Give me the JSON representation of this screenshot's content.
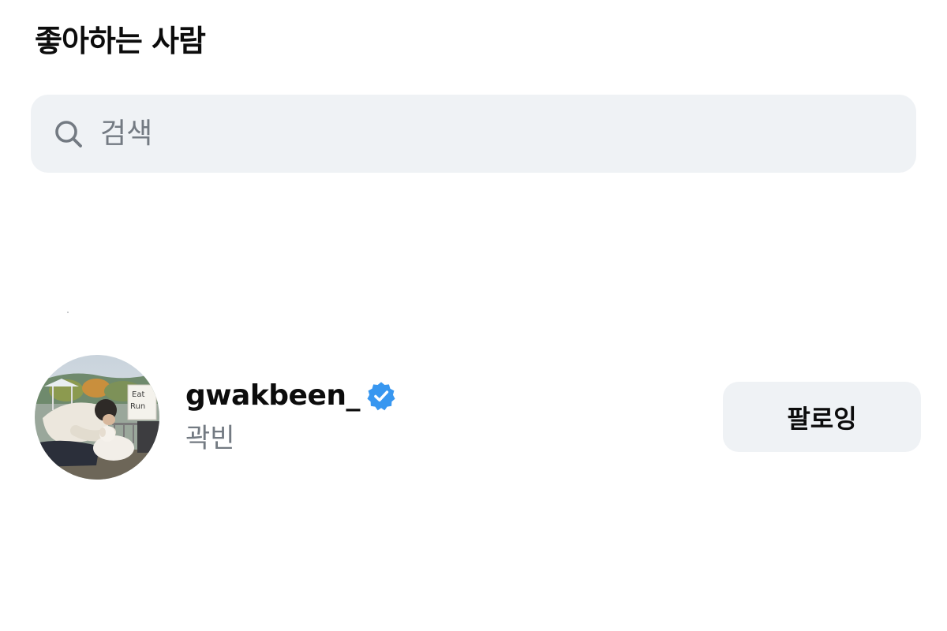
{
  "header": {
    "title": "좋아하는 사람"
  },
  "search": {
    "icon": "search-icon",
    "placeholder": "검색"
  },
  "likes_list": [
    {
      "username": "gwakbeen_",
      "verified": true,
      "full_name": "곽빈",
      "button_label": "팔로잉",
      "avatar": "profile-photo"
    }
  ],
  "colors": {
    "search_bg": "#eff2f5",
    "button_bg": "#eff2f5",
    "verified_badge": "#3897f0",
    "secondary_text": "#737a82",
    "primary_text": "#0c0c0c"
  }
}
